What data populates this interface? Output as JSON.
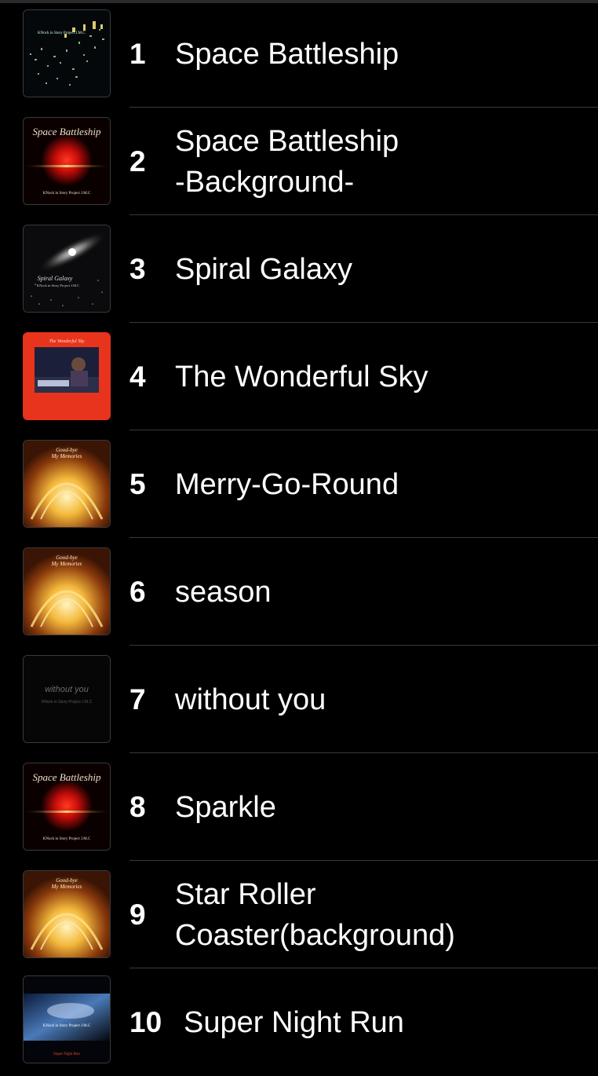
{
  "tracks": [
    {
      "number": "1",
      "title": "Space Battleship",
      "art": "space-battleship-city-art",
      "art_caption": "Space Battleship"
    },
    {
      "number": "2",
      "title": "Space Battleship\n-Background-",
      "art": "space-battleship-red-art",
      "art_caption": "Space Battleship"
    },
    {
      "number": "3",
      "title": "Spiral Galaxy",
      "art": "spiral-galaxy-art",
      "art_caption": "Spiral Galaxy"
    },
    {
      "number": "4",
      "title": "The Wonderful Sky",
      "art": "wonderful-sky-art",
      "art_caption": "The Wonderful Sky"
    },
    {
      "number": "5",
      "title": "Merry-Go-Round",
      "art": "goodbye-my-memories-art",
      "art_caption": "Good-bye My Memories"
    },
    {
      "number": "6",
      "title": "season",
      "art": "goodbye-my-memories-art",
      "art_caption": "Good-bye My Memories"
    },
    {
      "number": "7",
      "title": "without you",
      "art": "without-you-art",
      "art_caption": "without you"
    },
    {
      "number": "8",
      "title": "Sparkle",
      "art": "space-battleship-red-art",
      "art_caption": "Space Battleship"
    },
    {
      "number": "9",
      "title": "Star Roller\nCoaster(background)",
      "art": "goodbye-my-memories-art",
      "art_caption": "Good-bye My Memories"
    },
    {
      "number": "10",
      "title": "Super Night Run",
      "art": "super-night-run-art",
      "art_caption": "Super Night Run"
    }
  ],
  "colors": {
    "background": "#000000",
    "text": "#ffffff",
    "separator": "#3a3a3c",
    "art_red": "#e8341c"
  },
  "art_text": {
    "band": "KNock in Story Project J.M.C",
    "space_battleship": "Space Battleship",
    "spiral_galaxy": "Spiral Galaxy",
    "wonderful_sky": "The Wonderful Sky",
    "goodbye": "Good-bye",
    "memories": "My Memories",
    "without_you": "without you",
    "super_night_run": "Super Night Run"
  }
}
